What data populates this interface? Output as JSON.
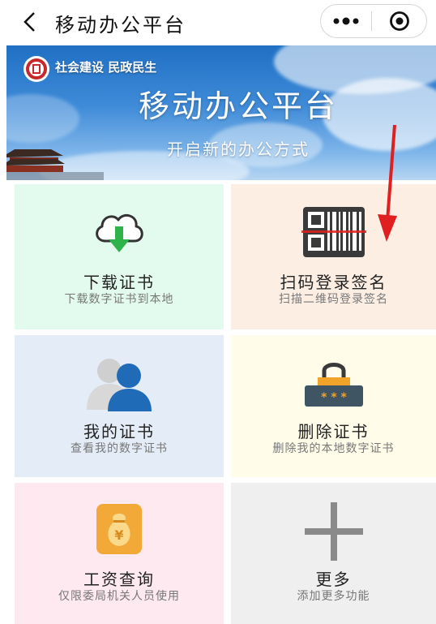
{
  "nav": {
    "title": "移动办公平台"
  },
  "banner": {
    "slogan": "社会建设 民政民生",
    "title": "移动办公平台",
    "subtitle": "开启新的办公方式"
  },
  "tiles": [
    {
      "title": "下载证书",
      "desc": "下载数字证书到本地",
      "bg": "#e3fbee",
      "icon": "cloud-download-icon"
    },
    {
      "title": "扫码登录签名",
      "desc": "扫描二维码登录签名",
      "bg": "#fdeee4",
      "icon": "qr-scan-icon"
    },
    {
      "title": "我的证书",
      "desc": "查看我的数字证书",
      "bg": "#e4edf7",
      "icon": "users-icon"
    },
    {
      "title": "删除证书",
      "desc": "删除我的本地数字证书",
      "bg": "#fffdea",
      "icon": "lock-icon"
    },
    {
      "title": "工资查询",
      "desc": "仅限委局机关人员使用",
      "bg": "#fde9ef",
      "icon": "money-bag-icon"
    },
    {
      "title": "更多",
      "desc": "添加更多功能",
      "bg": "#efefef",
      "icon": "plus-icon"
    }
  ],
  "colors": {
    "arrow": "#e02020",
    "banner_blue": "#2f7fd0"
  }
}
